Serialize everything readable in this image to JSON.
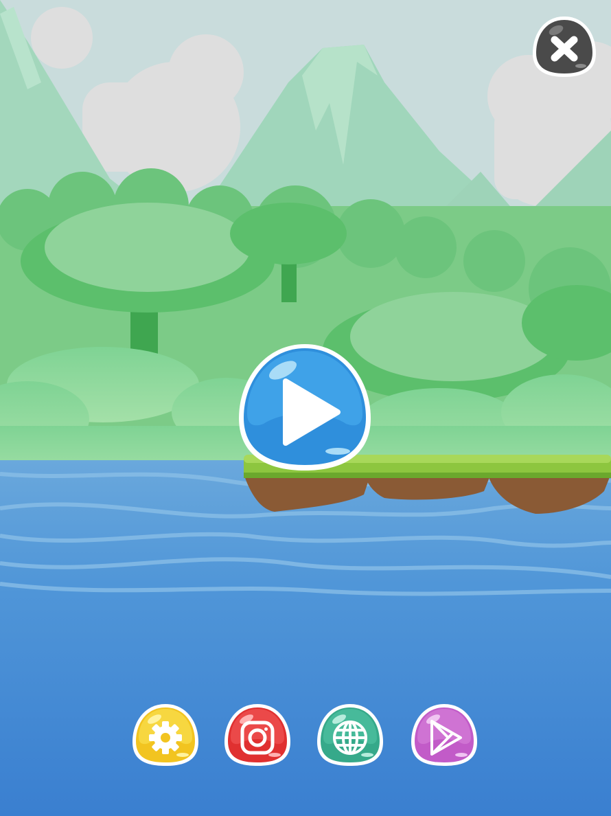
{
  "game": {
    "screen": "main-menu",
    "colors": {
      "sky": "#c7dcdc",
      "mountain": "#a8d8c0",
      "water_top": "#5d9fd9",
      "water_bottom": "#3a7fd0",
      "grass": "#8dc63f",
      "dirt": "#8a5a35"
    },
    "buttons": {
      "close": {
        "icon": "close-icon",
        "color": "#4a4a4a"
      },
      "play": {
        "icon": "play-icon",
        "color": "#2f8fdc"
      },
      "bottom": [
        {
          "id": "settings",
          "icon": "gear-icon",
          "color": "#f2c420"
        },
        {
          "id": "instagram",
          "icon": "instagram-icon",
          "color": "#e03030"
        },
        {
          "id": "website",
          "icon": "globe-icon",
          "color": "#36a98a"
        },
        {
          "id": "more-games",
          "icon": "play-store-icon",
          "color": "#c25bc8"
        }
      ]
    }
  }
}
